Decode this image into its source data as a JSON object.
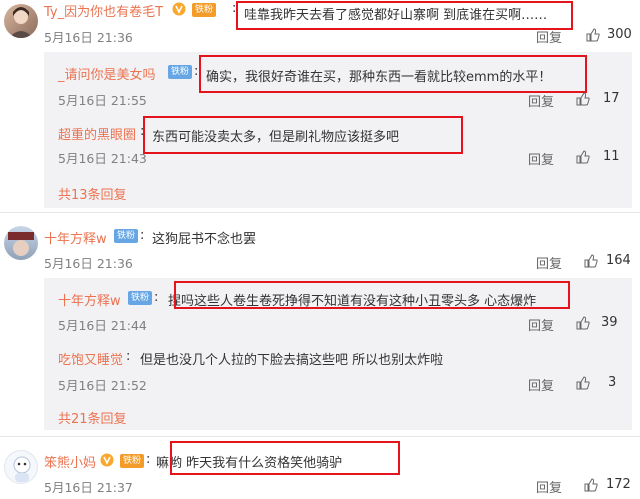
{
  "threads": [
    {
      "main": {
        "username": "Ty_因为你也有卷毛T",
        "badge": "铁粉",
        "text": "哇靠我昨天去看了感觉都好山寨啊 到底谁在买啊……",
        "time": "5月16日 21:36",
        "reply_label": "回复",
        "likes": "300"
      },
      "replies": [
        {
          "username": "_请问你是美女吗",
          "badge": "铁粉",
          "text": "确实，我很好奇谁在买，那种东西一看就比较emm的水平！",
          "time": "5月16日 21:55",
          "reply_label": "回复",
          "likes": "17"
        },
        {
          "username": "超重的黑眼圈",
          "text": "东西可能没卖太多，但是刷礼物应该挺多吧",
          "time": "5月16日 21:43",
          "reply_label": "回复",
          "likes": "11"
        }
      ],
      "more": "共13条回复"
    },
    {
      "main": {
        "username": "十年方释w",
        "badge": "铁粉",
        "text": "这狗屁书不念也罢",
        "time": "5月16日 21:36",
        "reply_label": "回复",
        "likes": "164"
      },
      "replies": [
        {
          "username": "十年方释w",
          "badge": "铁粉",
          "text": "捏吗这些人卷生卷死挣得不知道有没有这种小丑零头多 心态爆炸",
          "time": "5月16日 21:44",
          "reply_label": "回复",
          "likes": "39"
        },
        {
          "username": "吃饱又睡觉",
          "text": "但是也没几个人拉的下脸去搞这些吧 所以也别太炸啦",
          "time": "5月16日 21:52",
          "reply_label": "回复",
          "likes": "3"
        }
      ],
      "more": "共21条回复"
    },
    {
      "main": {
        "username": "笨熊小妈",
        "badge": "铁粉",
        "text": "嘛哟 昨天我有什么资格笑他骑驴",
        "time": "5月16日 21:37",
        "reply_label": "回复",
        "likes": "172"
      }
    }
  ],
  "colors": {
    "username": "#eb7350",
    "badge": "#66a6e5",
    "highlight": "#e5131b",
    "subbox": "#f2f2f5"
  },
  "icons": {
    "like": "thumbs-up-icon",
    "verified": "v-badge-icon"
  }
}
